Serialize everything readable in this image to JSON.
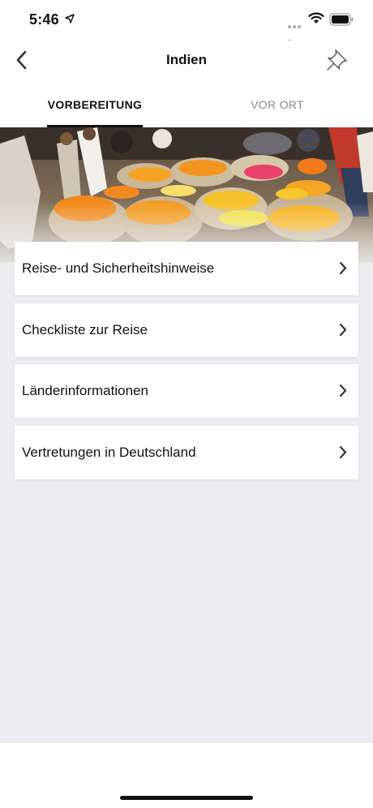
{
  "status_bar": {
    "time": "5:46",
    "location_icon": "location-arrow-icon",
    "signal_icon": "signal-dots-icon",
    "wifi_icon": "wifi-icon",
    "battery_icon": "battery-icon"
  },
  "nav": {
    "title": "Indien",
    "back_icon": "chevron-left-icon",
    "pin_icon": "pin-icon"
  },
  "tabs": [
    {
      "label": "VORBEREITUNG",
      "active": true
    },
    {
      "label": "VOR ORT",
      "active": false
    }
  ],
  "hero": {
    "description_icon": "hero-photo"
  },
  "menu": {
    "items": [
      {
        "label": "Reise- und Sicherheitshinweise"
      },
      {
        "label": "Checkliste zur Reise"
      },
      {
        "label": "Länderinformationen"
      },
      {
        "label": "Vertretungen in Deutschland"
      }
    ]
  },
  "colors": {
    "background": "#ededf1",
    "card": "#ffffff",
    "text": "#111111",
    "inactive_tab": "#888888"
  }
}
